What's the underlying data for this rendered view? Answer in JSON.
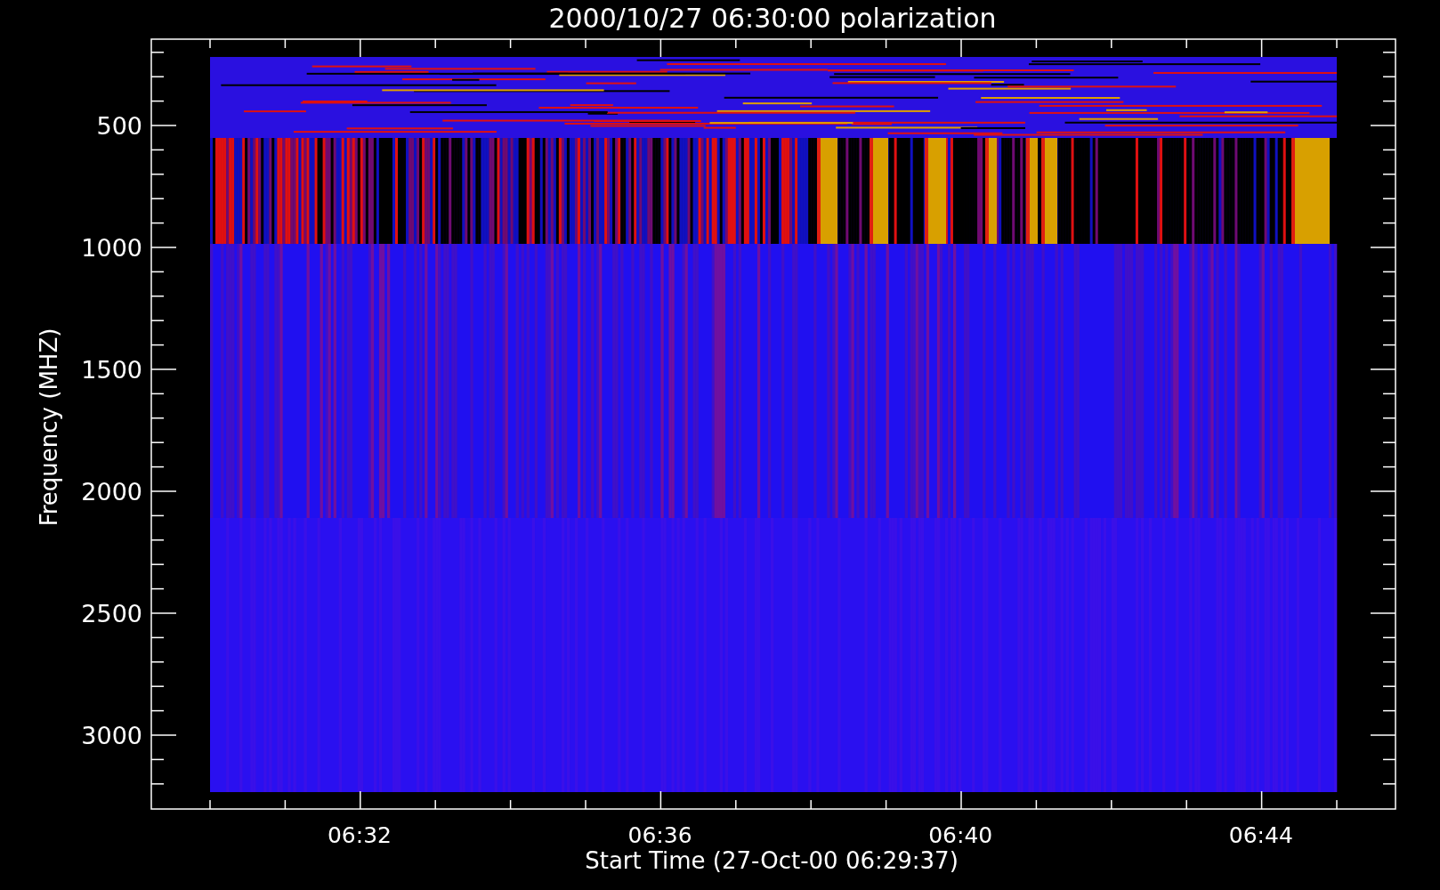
{
  "plot": {
    "title": "2000/10/27 06:30:00 polarization",
    "xlabel": "Start Time (27-Oct-00 06:29:37)",
    "ylabel": "Frequency (MHZ)",
    "y_tick_labels": [
      "500",
      "1000",
      "1500",
      "2000",
      "2500",
      "3000"
    ],
    "x_tick_labels": [
      "06:32",
      "06:36",
      "06:40",
      "06:44"
    ]
  }
}
